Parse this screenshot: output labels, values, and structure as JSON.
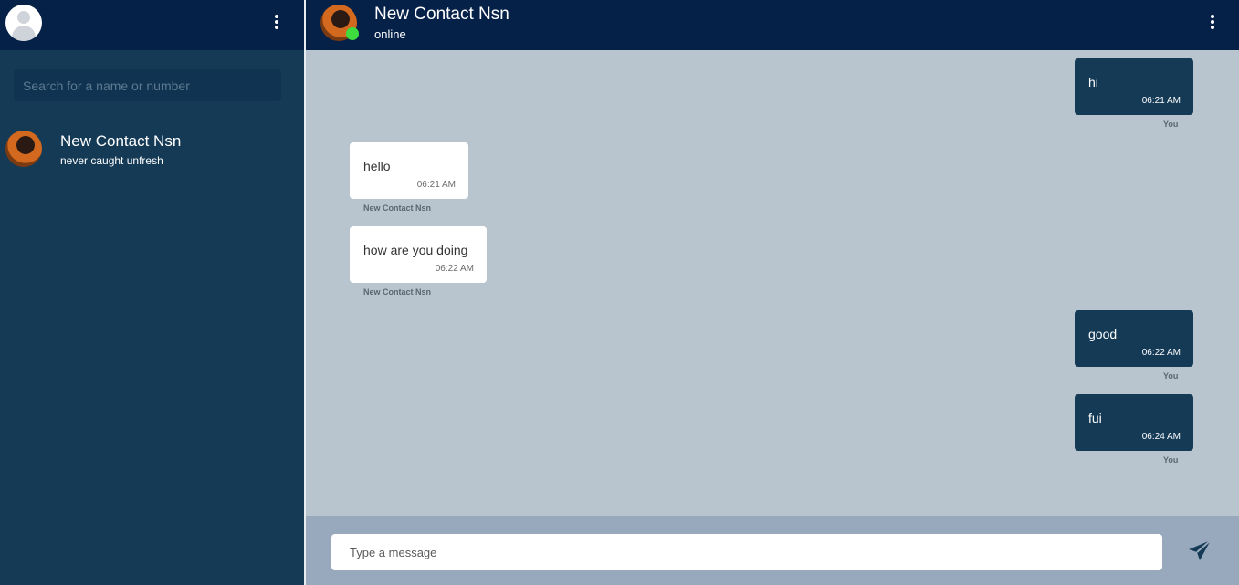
{
  "sidebar": {
    "search": {
      "placeholder": "Search for a name or number",
      "value": ""
    },
    "contacts": [
      {
        "name": "New Contact Nsn",
        "status": "never caught unfresh"
      }
    ]
  },
  "chat": {
    "title": "New Contact Nsn",
    "presence": "online",
    "messages": [
      {
        "text": "hi",
        "time": "06:21 AM",
        "sender": "You",
        "direction": "out"
      },
      {
        "text": "hello",
        "time": "06:21 AM",
        "sender": "New Contact Nsn",
        "direction": "in"
      },
      {
        "text": "how are you doing",
        "time": "06:22 AM",
        "sender": "New Contact Nsn",
        "direction": "in"
      },
      {
        "text": "good",
        "time": "06:22 AM",
        "sender": "You",
        "direction": "out"
      },
      {
        "text": "fui",
        "time": "06:24 AM",
        "sender": "You",
        "direction": "out"
      }
    ],
    "composer": {
      "placeholder": "Type a message",
      "value": ""
    }
  },
  "icons": {
    "menu": "vertical-dots-icon",
    "send": "paper-plane-icon",
    "avatar_placeholder": "user-icon"
  },
  "colors": {
    "sidebar_bg": "#143a56",
    "header_bg": "#052148",
    "chat_bg": "#b8c5cf",
    "outgoing_bubble": "#143a56",
    "incoming_bubble": "#ffffff",
    "online": "#3fdc3f"
  }
}
